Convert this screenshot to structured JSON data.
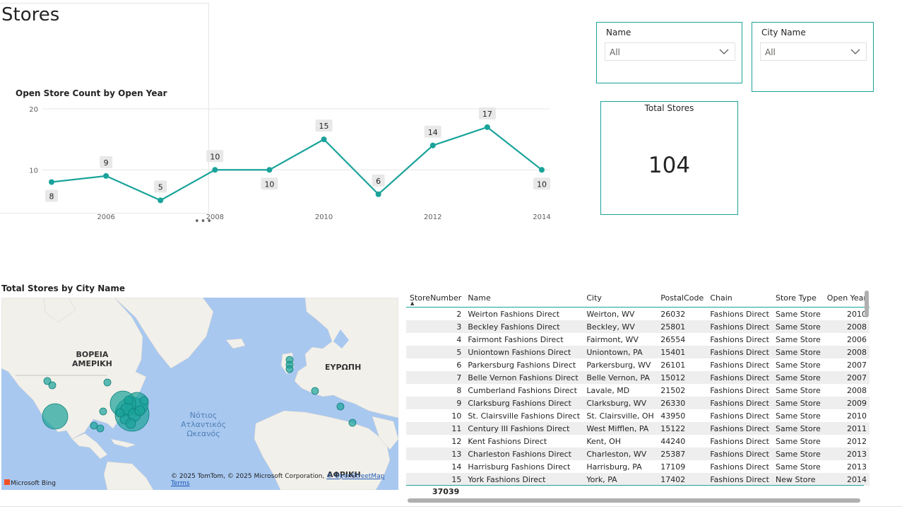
{
  "page": {
    "title": "Stores"
  },
  "slicers": [
    {
      "title": "Name",
      "value": "All"
    },
    {
      "title": "City Name",
      "value": "All"
    }
  ],
  "card": {
    "label": "Total Stores",
    "value": "104"
  },
  "line_chart_title": "Open Store Count by Open Year",
  "chart_data": {
    "type": "line",
    "title": "Open Store Count by Open Year",
    "x": [
      2005,
      2006,
      2007,
      2008,
      2009,
      2010,
      2011,
      2012,
      2013,
      2014
    ],
    "series": [
      {
        "values": [
          8,
          9,
          5,
          10,
          10,
          15,
          6,
          14,
          17,
          10
        ]
      }
    ],
    "data_labels": [
      "8",
      "9",
      "5",
      "10",
      "10",
      "15",
      "6",
      "14",
      "17",
      "10"
    ],
    "x_tick_labels": [
      "2006",
      "2008",
      "2010",
      "2012",
      "2014"
    ],
    "y_tick_labels": [
      "10",
      "20"
    ],
    "ylim": [
      4,
      20
    ],
    "grid": true,
    "color": "#1aa39a"
  },
  "map": {
    "title": "Total Stores by City Name",
    "labels": {
      "north_america": "ΒΟΡΕΙΑ\nΑΜΕΡΙΚΗ",
      "europe": "ΕΥΡΩΠΗ",
      "africa": "ΑΦΡΙΚΗ",
      "ocean": "Νότιος\nΑτλαντικός\nΩκεανός"
    },
    "logo": "Microsoft Bing",
    "copyright": "© 2025 TomTom, © 2025 Microsoft Corporation,",
    "osm_link": "© OpenStreetMap",
    "terms_link": "Terms",
    "bubble_color": "#1aa39a"
  },
  "table": {
    "columns": [
      "StoreNumber",
      "Name",
      "City",
      "PostalCode",
      "Chain",
      "Store Type",
      "Open Year"
    ],
    "rows": [
      [
        "2",
        "Weirton Fashions Direct",
        "Weirton, WV",
        "26032",
        "Fashions Direct",
        "Same Store",
        "2010"
      ],
      [
        "3",
        "Beckley Fashions Direct",
        "Beckley, WV",
        "25801",
        "Fashions Direct",
        "Same Store",
        "2008"
      ],
      [
        "4",
        "Fairmont Fashions Direct",
        "Fairmont, WV",
        "26554",
        "Fashions Direct",
        "Same Store",
        "2006"
      ],
      [
        "5",
        "Uniontown Fashions Direct",
        "Uniontown, PA",
        "15401",
        "Fashions Direct",
        "Same Store",
        "2008"
      ],
      [
        "6",
        "Parkersburg Fashions Direct",
        "Parkersburg, WV",
        "26101",
        "Fashions Direct",
        "Same Store",
        "2007"
      ],
      [
        "7",
        "Belle Vernon Fashions Direct",
        "Belle Vernon, PA",
        "15012",
        "Fashions Direct",
        "Same Store",
        "2007"
      ],
      [
        "8",
        "Cumberland Fashions Direct",
        "Lavale, MD",
        "21502",
        "Fashions Direct",
        "Same Store",
        "2008"
      ],
      [
        "9",
        "Clarksburg Fashions Direct",
        "Clarksburg, WV",
        "26330",
        "Fashions Direct",
        "Same Store",
        "2009"
      ],
      [
        "10",
        "St. Clairsville Fashions Direct",
        "St. Clairsville, OH",
        "43950",
        "Fashions Direct",
        "Same Store",
        "2010"
      ],
      [
        "11",
        "Century III Fashions Direct",
        "West Mifflen, PA",
        "15122",
        "Fashions Direct",
        "Same Store",
        "2011"
      ],
      [
        "12",
        "Kent Fashions Direct",
        "Kent, OH",
        "44240",
        "Fashions Direct",
        "Same Store",
        "2012"
      ],
      [
        "13",
        "Charleston Fashions Direct",
        "Charleston, WV",
        "25387",
        "Fashions Direct",
        "Same Store",
        "2013"
      ],
      [
        "14",
        "Harrisburg Fashions Direct",
        "Harrisburg, PA",
        "17109",
        "Fashions Direct",
        "Same Store",
        "2013"
      ],
      [
        "15",
        "York Fashions Direct",
        "York, PA",
        "17402",
        "Fashions Direct",
        "New Store",
        "2014"
      ]
    ],
    "total": "37039"
  }
}
